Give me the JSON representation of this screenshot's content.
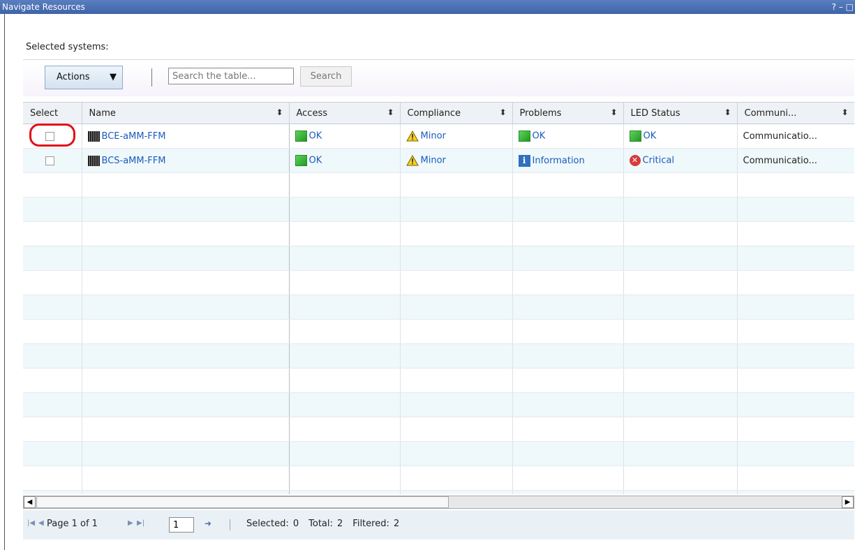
{
  "window": {
    "title": "Navigate Resources",
    "controls": "? – □"
  },
  "selected_label": "Selected systems:",
  "toolbar": {
    "actions_label": "Actions",
    "search_placeholder": "Search the table...",
    "search_label": "Search"
  },
  "columns": [
    "Select",
    "Name",
    "Access",
    "Compliance",
    "Problems",
    "LED Status",
    "Communi..."
  ],
  "rows": [
    {
      "name": "BCE-aMM-FFM",
      "access": "OK",
      "compliance": "Minor",
      "problems": "OK",
      "led_status": "OK",
      "communication": "Communicatio..."
    },
    {
      "name": "BCS-aMM-FFM",
      "access": "OK",
      "compliance": "Minor",
      "problems": "Information",
      "led_status": "Critical",
      "communication": "Communicatio..."
    }
  ],
  "footer": {
    "page_label": "Page 1 of 1",
    "page_value": "1",
    "selected": "Selected: 0",
    "total": "Total: 2",
    "filtered": "Filtered: 2"
  },
  "colors": {
    "link": "#1b5bbb",
    "title_bar": "#4a6fb2",
    "highlight": "#e0101a"
  }
}
